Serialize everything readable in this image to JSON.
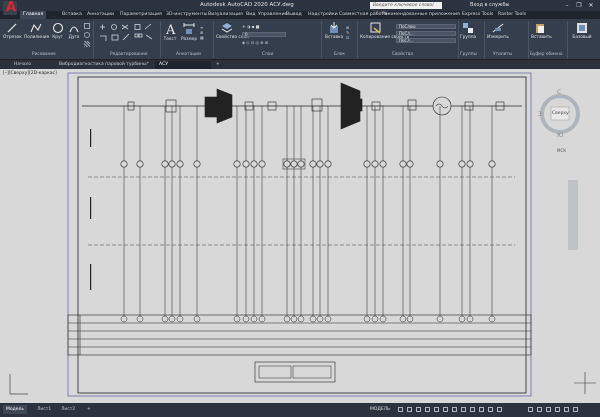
{
  "app": {
    "title": "Autodesk AutoCAD 2020    АСУ.dwg",
    "logo_letter": "A",
    "search_placeholder": "Введите ключевое слово/фразу",
    "signin": "Вход в службы",
    "window_buttons": [
      "–",
      "❐",
      "✕"
    ]
  },
  "ribbon_tabs": [
    "Главная",
    "Вставка",
    "Аннотации",
    "Параметризация",
    "3D-инструменты",
    "Визуализация",
    "Вид",
    "Управление",
    "Вывод",
    "Надстройки",
    "Совместная работа",
    "Рекомендованные приложения",
    "Express Tools",
    "Raster Tools"
  ],
  "ribbon": {
    "draw": {
      "buttons": [
        "Отрезок",
        "Полилиния",
        "Круг",
        "Дуга"
      ],
      "label": "Рисование"
    },
    "modify": {
      "label": "Редактирование"
    },
    "annotation": {
      "buttons": [
        "Текст",
        "Размер"
      ],
      "label": "Аннотации"
    },
    "layers": {
      "buttons": [
        "Свойства слоя"
      ],
      "label": "Слои",
      "combo": "0"
    },
    "block": {
      "buttons": [
        "Вставка"
      ],
      "label": "Блок"
    },
    "properties": {
      "buttons": [
        "Копирование свойств"
      ],
      "label": "Свойства",
      "combos": [
        "ПоСлою",
        "ПоСл...",
        "ПоСл..."
      ]
    },
    "groups": {
      "buttons": [
        "Группа"
      ],
      "label": "Группы"
    },
    "utilities": {
      "buttons": [
        "Измерить"
      ],
      "label": "Утилиты"
    },
    "clipboard": {
      "buttons": [
        "Вставить"
      ],
      "label": "Буфер обмена"
    },
    "base": {
      "buttons": [
        "Базовый"
      ]
    }
  },
  "doc_tabs": [
    "Начало",
    "Вибродиагностика паровой турбины*",
    "АСУ"
  ],
  "viewport": {
    "label": "[–][Сверху][2D-каркас]"
  },
  "viewcube": {
    "n": "С",
    "s": "Ю",
    "w": "З",
    "face": "Сверху",
    "ucs": "МСК"
  },
  "status_tabs": [
    "Модель",
    "Лист1",
    "Лист2"
  ],
  "status_right": "МОДЕЛЬ",
  "colors": {
    "accent": "#3d4756",
    "canvas": "#d8d8d8",
    "logo_red": "#d62a2a"
  }
}
